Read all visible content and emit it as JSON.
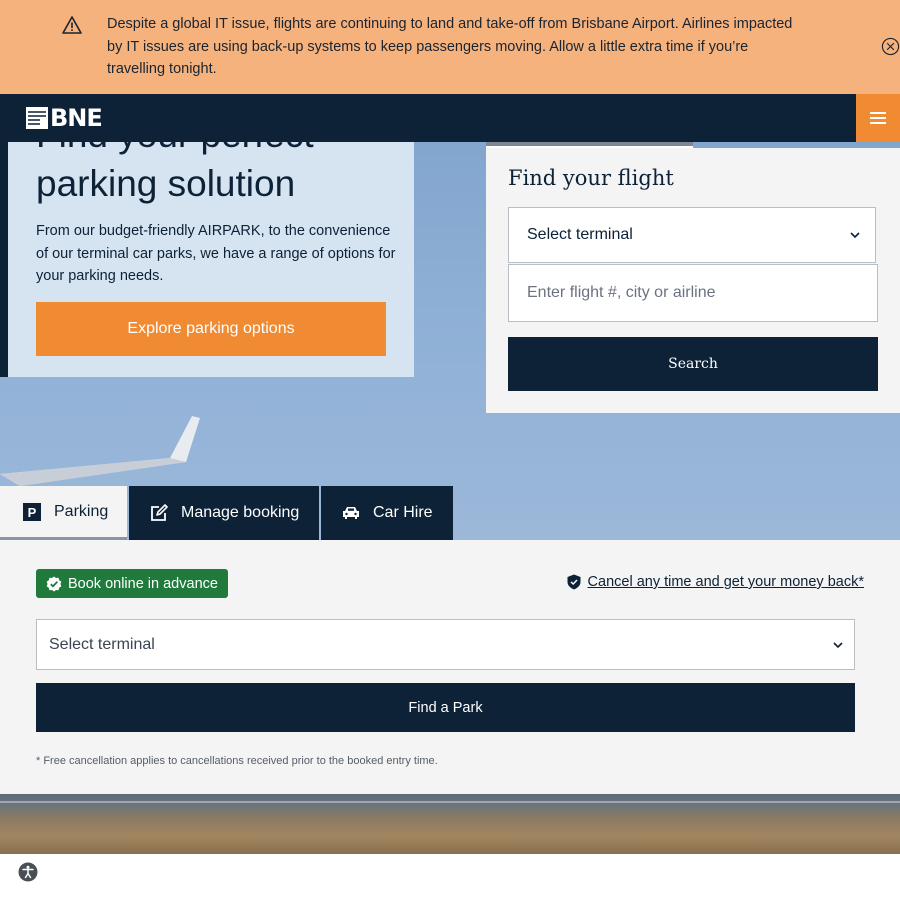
{
  "alert": {
    "message": "Despite a global IT issue, flights are continuing to land and take-off from Brisbane Airport. Airlines impacted by IT issues are using back-up systems to keep passengers moving. Allow a little extra time if you’re travelling tonight.",
    "icon": "warning-icon",
    "close_icon": "close-circle-icon",
    "color": "#f6b27c"
  },
  "header": {
    "logo_text": "BNE",
    "menu_icon": "hamburger-icon",
    "color": "#0d2137",
    "accent": "#f08a33"
  },
  "hero": {
    "title": "Find your perfect parking solution",
    "description": "From our budget-friendly AIRPARK, to the convenience of our terminal car parks, we have a range of options for your parking needs.",
    "button_label": "Explore parking options"
  },
  "flight_search": {
    "title": "Find your flight",
    "terminal_select": "Select terminal",
    "flight_placeholder": "Enter flight #, city or airline",
    "search_label": "Search"
  },
  "tabs": [
    {
      "label": "Parking",
      "icon": "parking-icon",
      "active": true
    },
    {
      "label": "Manage booking",
      "icon": "edit-icon",
      "active": false
    },
    {
      "label": "Car Hire",
      "icon": "car-icon",
      "active": false
    }
  ],
  "parking_panel": {
    "badge_label": "Book online in advance",
    "badge_color": "#1f7a3c",
    "cancel_link": "Cancel any time and get your money back*",
    "terminal_select": "Select terminal",
    "find_button": "Find a Park",
    "footnote": "* Free cancellation applies to cancellations received prior to the booked entry time."
  },
  "accessibility_icon": "accessibility-icon"
}
